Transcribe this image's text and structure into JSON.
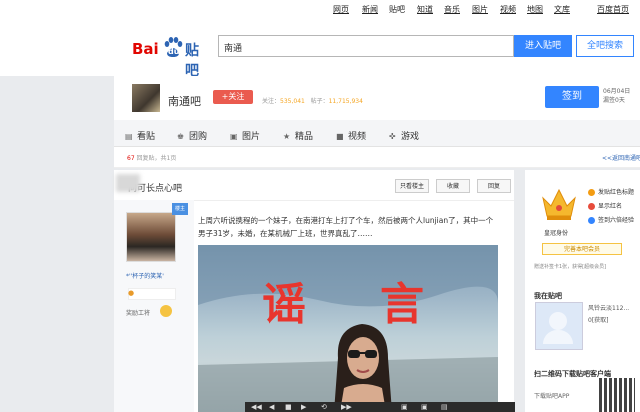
{
  "topnav": [
    "网页",
    "新闻",
    "贴吧",
    "知道",
    "音乐",
    "图片",
    "视频",
    "地图",
    "文库",
    "百度首页"
  ],
  "logo": {
    "bai": "Bai",
    "du": "du",
    "tieba": "贴吧"
  },
  "search": {
    "value": "南通",
    "enter_button": "进入贴吧",
    "all_button": "全吧搜索"
  },
  "forum": {
    "name": "南通吧",
    "follow": "+关注",
    "followers_label": "关注：",
    "followers": "535,041",
    "posts_label": "帖子：",
    "posts": "11,715,934",
    "sign_button": "签到",
    "date": "06月04日",
    "date_sub": "漏签0天"
  },
  "tabs": [
    {
      "icon": "▤",
      "label": "看贴",
      "name": "tab-posts"
    },
    {
      "icon": "♚",
      "label": "团购",
      "name": "tab-groupbuy"
    },
    {
      "icon": "▣",
      "label": "图片",
      "name": "tab-pictures"
    },
    {
      "icon": "★",
      "label": "精品",
      "name": "tab-featured"
    },
    {
      "icon": "■",
      "label": "视频",
      "name": "tab-video"
    },
    {
      "icon": "✜",
      "label": "游戏",
      "name": "tab-games"
    }
  ],
  "subbar": {
    "reply_count": "67",
    "reply_text": " 回复贴，共1页",
    "back": "<<返回南通吧"
  },
  "post": {
    "title": "问可长点心吧",
    "buttons": [
      "只看楼主",
      "收藏",
      "回复"
    ],
    "louzhu": "楼主",
    "username": "*''杯子的笑某'",
    "role": "奖励工将",
    "text": "上周六听说携程的一个妹子，在南港打车上打了个车，然后被两个人lunjian了，其中一个男子31岁，未婚，在某机械厂上班，世界真乱了……",
    "overlay_text": [
      "谣",
      "言"
    ]
  },
  "sidebar": {
    "badges": [
      "发贴红色标题",
      "显示红名",
      "签到六倍经验"
    ],
    "crown_label": "皇冠身份",
    "apply_button": "完善本吧会员",
    "note": "赠送补签卡1张，获得[超级会员]",
    "me_title": "我在贴吧",
    "me_info": [
      "风铃云淡112...",
      "0[获取]"
    ],
    "app_title": "扫二维码下载贴吧客户端",
    "app_sub": "下载贴吧APP"
  },
  "bottombar": [
    "◀◀",
    "◀",
    "■",
    "▶",
    "⟲",
    "▶▶",
    "▣",
    "▣",
    "▤"
  ],
  "colors": {
    "accent": "#3385ff",
    "follow": "#ea5b4f",
    "rumor": "#e8352d"
  }
}
